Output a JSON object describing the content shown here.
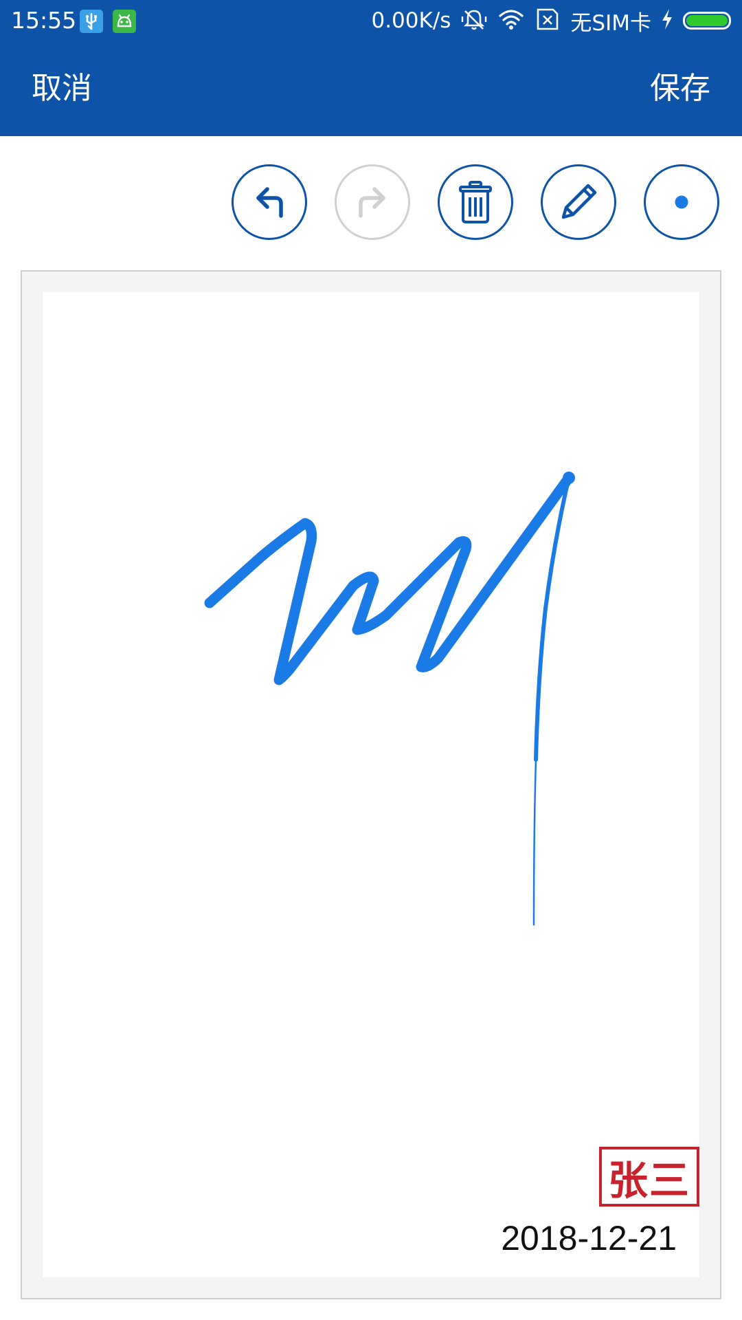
{
  "status_bar": {
    "time": "15:55",
    "app_icons": [
      {
        "name": "usb-icon",
        "color": "#3aa0e8"
      },
      {
        "name": "android-debug-icon",
        "color": "#3cb846"
      }
    ],
    "network_speed": "0.00K/s",
    "icons": [
      "vibrate-icon",
      "wifi-icon",
      "no-sim-icon"
    ],
    "carrier": "无SIM卡",
    "charging_icon": "bolt-icon",
    "battery_level": 1.0,
    "battery_color": "#32c92e"
  },
  "app_bar": {
    "cancel_label": "取消",
    "save_label": "保存",
    "background_color": "#0d53a8"
  },
  "toolbar": {
    "buttons": [
      {
        "name": "undo-button",
        "icon": "undo-arrow-icon",
        "enabled": true
      },
      {
        "name": "redo-button",
        "icon": "redo-arrow-icon",
        "enabled": false
      },
      {
        "name": "clear-button",
        "icon": "trash-icon",
        "enabled": true
      },
      {
        "name": "pen-button",
        "icon": "pencil-icon",
        "enabled": true
      },
      {
        "name": "pen-size-button",
        "icon": "dot-icon",
        "enabled": true
      }
    ],
    "accent_color": "#0d53a8",
    "disabled_color": "#d0d0d0"
  },
  "signature_pad": {
    "stroke_color": "#1a7be6",
    "seal_text": "张三",
    "seal_color": "#c8232c",
    "date": "2018-12-21"
  }
}
